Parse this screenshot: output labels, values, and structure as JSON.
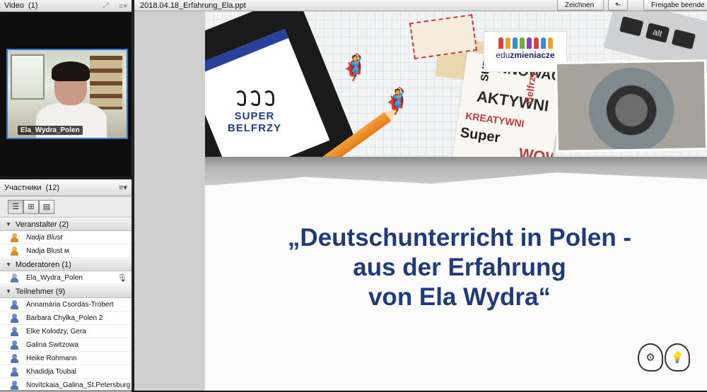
{
  "video_pod": {
    "title": "Video",
    "count": "(1)",
    "participant_name": "Ela_Wydra_Polen"
  },
  "attendee_pod": {
    "title": "Участники",
    "count": "(12)",
    "groups": [
      {
        "label": "Veranstalter (2)",
        "members": [
          {
            "name": "Nadja Blust",
            "role": "host",
            "italic": true
          },
          {
            "name": "Nadja Blust м",
            "role": "host",
            "italic": false
          }
        ]
      },
      {
        "label": "Moderatoren (1)",
        "members": [
          {
            "name": "Ela_Wydra_Polen",
            "role": "mod",
            "italic": false
          }
        ]
      },
      {
        "label": "Teilnehmer (9)",
        "members": [
          {
            "name": "Annamária Csordás-Tróbert",
            "role": "participant",
            "italic": false
          },
          {
            "name": "Barbara Chyłka_Polen 2",
            "role": "participant",
            "italic": false
          },
          {
            "name": "Elke Kolodzy, Gera",
            "role": "participant",
            "italic": false
          },
          {
            "name": "Galina Switzowa",
            "role": "participant",
            "italic": false
          },
          {
            "name": "Heike Rohmann",
            "role": "participant",
            "italic": false
          },
          {
            "name": "Khadidja Toubal",
            "role": "participant",
            "italic": false
          },
          {
            "name": "Novitckaia_Galina_St.Petersburg",
            "role": "participant",
            "italic": false
          }
        ]
      }
    ]
  },
  "share_pod": {
    "file_name": "2018.04.18_Erfahrung_Ela.ppt",
    "draw_button": "Zeichnen",
    "stop_button": "Freigabe beende",
    "slide": {
      "logo_line1": "SUPER",
      "logo_line2": "BELFRZY",
      "edu_logo_prefix": "edu",
      "edu_logo_suffix": "zmieniacze",
      "key_alt": "alt",
      "title_line1": "„Deutschunterricht in Polen -",
      "title_line2": "aus der Erfahrung",
      "title_line3": "von Ela Wydra“",
      "wordcloud": [
        "SUPER",
        "INNOWACJE",
        "AKTYWNI",
        "Belfrzy",
        "KREATYWNI",
        "Super",
        "WOW"
      ]
    }
  },
  "colors": {
    "title_blue": "#1f3b78",
    "logo_blue": "#1e3e96",
    "video_border": "#3a78c8"
  }
}
